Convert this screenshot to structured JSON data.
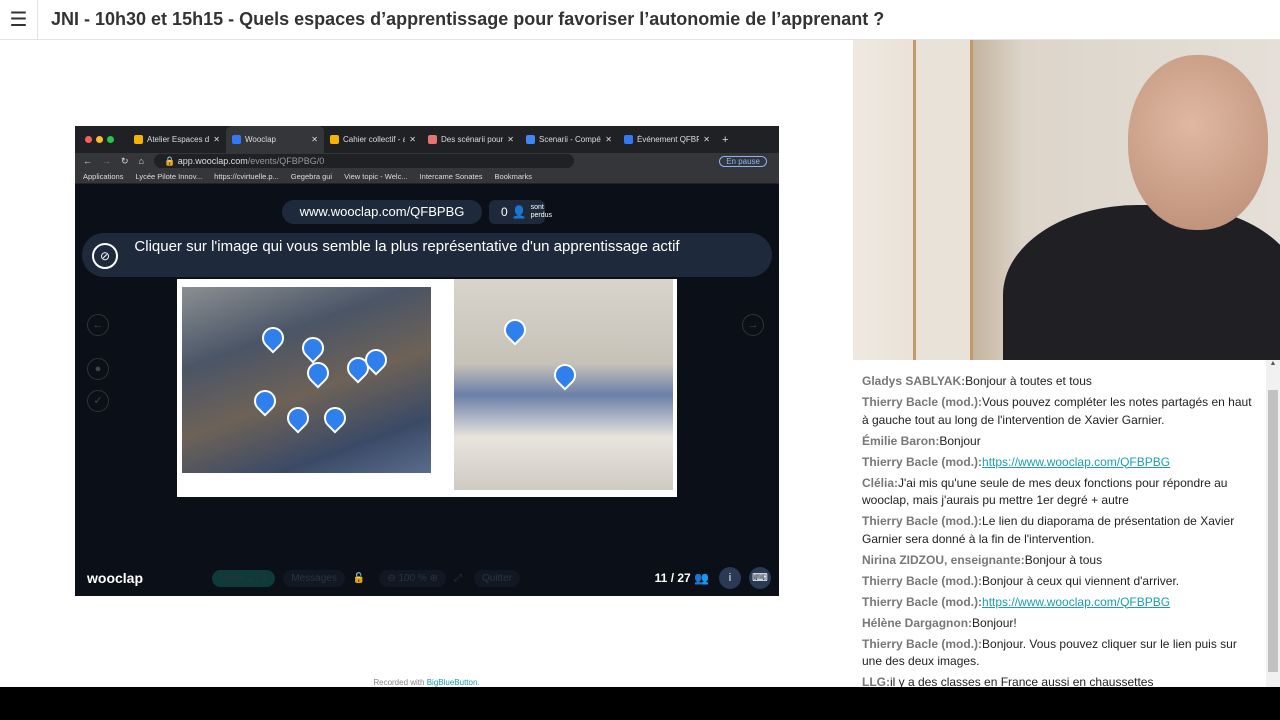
{
  "header": {
    "title": "JNI - 10h30 et 15h15 - Quels espaces d’apprentissage pour favoriser l’autonomie de l’apprenant ?",
    "menu_icon": "hamburger-icon"
  },
  "browser": {
    "tabs": [
      {
        "label": "Atelier Espaces d'a",
        "color": "#f4b400"
      },
      {
        "label": "Wooclap",
        "color": "#3478f6"
      },
      {
        "label": "Cahier collectif - a",
        "color": "#f4b400"
      },
      {
        "label": "Des scénarii pour",
        "color": "#e57373"
      },
      {
        "label": "Scenarii - Compét",
        "color": "#4285f4"
      },
      {
        "label": "Événement QFBPB",
        "color": "#3478f6"
      }
    ],
    "url_host": "app.wooclap.com",
    "url_path": "/events/QFBPBG/0",
    "profile": "En pause",
    "bookmarks": [
      "Applications",
      "Lycée Pilote Innov...",
      "https://cvirtuelle.p...",
      "Gegebra gui",
      "View topic - Welc...",
      "Intercame Sonates",
      "Bookmarks"
    ]
  },
  "wooclap": {
    "join_url": "www.wooclap.com/QFBPBG",
    "lost_count": "0",
    "lost_label_1": "sont",
    "lost_label_2": "perdus",
    "question": "Cliquer sur l'image qui vous semble la plus représentative d'un apprentissage actif",
    "logo": "wooclap",
    "votes_label": "Votes",
    "votes_value": "2",
    "votes_total": "/ 1",
    "messages": "Messages",
    "zoom": "100 %",
    "quit": "Quitter",
    "participants": "11 / 27"
  },
  "chat": {
    "messages": [
      {
        "name": "Gladys SABLYAK:",
        "text": "Bonjour à toutes et tous"
      },
      {
        "name": "Thierry Bacle (mod.):",
        "text": "Vous pouvez compléter les notes partagés en haut à gauche tout au long de l'intervention de Xavier Garnier."
      },
      {
        "name": "Émilie Baron:",
        "text": "Bonjour"
      },
      {
        "name": "Thierry Bacle (mod.):",
        "link": "https://www.wooclap.com/QFBPBG"
      },
      {
        "name": "Clélia:",
        "text": "J'ai mis qu'une seule de mes deux fonctions pour répondre au wooclap, mais j'aurais pu mettre 1er degré + autre"
      },
      {
        "name": "Thierry Bacle (mod.):",
        "text": "Le lien du diaporama de présentation de Xavier Garnier sera donné à la fin de l'intervention."
      },
      {
        "name": "Nirina ZIDZOU, enseignante:",
        "text": "Bonjour à tous"
      },
      {
        "name": "Thierry Bacle (mod.):",
        "text": "Bonjour à ceux qui viennent d'arriver."
      },
      {
        "name": "Thierry Bacle (mod.):",
        "link": "https://www.wooclap.com/QFBPBG"
      },
      {
        "name": "Hélène Dargagnon:",
        "text": "Bonjour!"
      },
      {
        "name": "Thierry Bacle (mod.):",
        "text": "Bonjour. Vous pouvez cliquer sur le lien puis sur une des deux images."
      },
      {
        "name": "LLG:",
        "text": "il y a des classes en France aussi en chaussettes"
      }
    ]
  },
  "footer": {
    "recorded": "Recorded with ",
    "brand": "BigBlueButton",
    "dot": "."
  }
}
